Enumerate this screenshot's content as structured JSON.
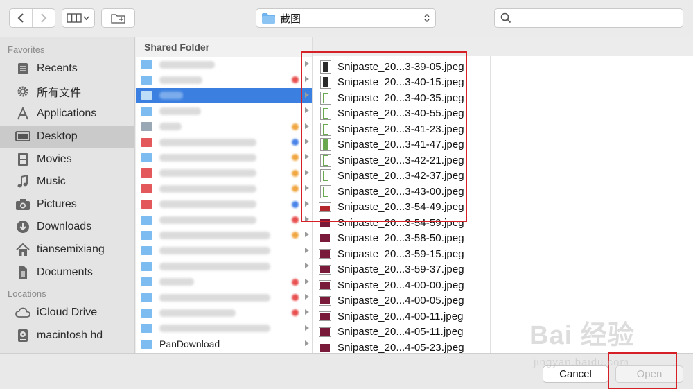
{
  "toolbar": {
    "back_icon": "chevron-left-icon",
    "forward_icon": "chevron-right-icon",
    "view_icon": "column-view-icon",
    "new_folder_icon": "new-folder-icon",
    "path_label": "截图",
    "search_placeholder": ""
  },
  "sidebar": {
    "favorites_header": "Favorites",
    "locations_header": "Locations",
    "favorites": [
      {
        "label": "Recents",
        "icon": "recents-icon"
      },
      {
        "label": "所有文件",
        "icon": "gear-icon"
      },
      {
        "label": "Applications",
        "icon": "applications-icon"
      },
      {
        "label": "Desktop",
        "icon": "desktop-icon",
        "selected": true
      },
      {
        "label": "Movies",
        "icon": "film-icon"
      },
      {
        "label": "Music",
        "icon": "music-note-icon"
      },
      {
        "label": "Pictures",
        "icon": "camera-icon"
      },
      {
        "label": "Downloads",
        "icon": "download-icon"
      },
      {
        "label": "tiansemixiang",
        "icon": "home-icon"
      },
      {
        "label": "Documents",
        "icon": "document-icon"
      }
    ],
    "locations": [
      {
        "label": "iCloud Drive",
        "icon": "cloud-icon"
      },
      {
        "label": "macintosh hd",
        "icon": "hard-drive-icon"
      }
    ]
  },
  "column1": {
    "header": "Shared Folder",
    "visible_label": "PanDownload"
  },
  "column2": {
    "files": [
      "Snipaste_20...3-39-05.jpeg",
      "Snipaste_20...3-40-15.jpeg",
      "Snipaste_20...3-40-35.jpeg",
      "Snipaste_20...3-40-55.jpeg",
      "Snipaste_20...3-41-23.jpeg",
      "Snipaste_20...3-41-47.jpeg",
      "Snipaste_20...3-42-21.jpeg",
      "Snipaste_20...3-42-37.jpeg",
      "Snipaste_20...3-43-00.jpeg",
      "Snipaste_20...3-54-49.jpeg",
      "Snipaste_20...3-54-59.jpeg",
      "Snipaste_20...3-58-50.jpeg",
      "Snipaste_20...3-59-15.jpeg",
      "Snipaste_20...3-59-37.jpeg",
      "Snipaste_20...4-00-00.jpeg",
      "Snipaste_20...4-00-05.jpeg",
      "Snipaste_20...4-00-11.jpeg",
      "Snipaste_20...4-05-11.jpeg",
      "Snipaste_20...4-05-23.jpeg"
    ]
  },
  "buttons": {
    "cancel": "Cancel",
    "open": "Open"
  },
  "watermark": {
    "main": "Bai 经验",
    "sub": "jingyan.baidu.com"
  },
  "colors": {
    "selection": "#3b7fe0",
    "folder": "#6fb3ee",
    "annotation": "#d42026"
  }
}
